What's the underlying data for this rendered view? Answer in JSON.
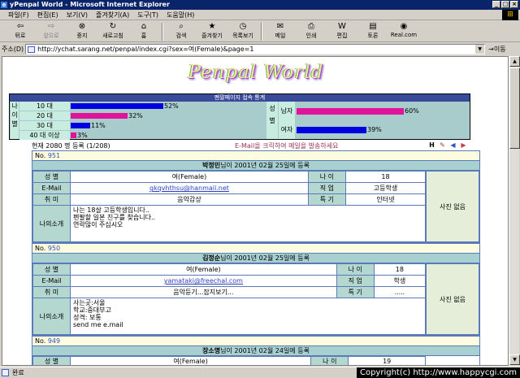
{
  "window": {
    "title": "yPenpal World - Microsoft Internet Explorer",
    "ie_glyph": "e",
    "min": "_",
    "max": "□",
    "close": "×"
  },
  "menu": [
    "파일(F)",
    "편집(E)",
    "보기(V)",
    "즐겨찾기(A)",
    "도구(T)",
    "도움말(H)"
  ],
  "toolbar": {
    "back": {
      "label": "뒤로",
      "icon": "⇦"
    },
    "forward": {
      "label": "앞으로",
      "icon": "⇨"
    },
    "stop": {
      "label": "중지",
      "icon": "⊗"
    },
    "refresh": {
      "label": "새로고침",
      "icon": "↻"
    },
    "home": {
      "label": "홈",
      "icon": "⌂"
    },
    "search": {
      "label": "검색",
      "icon": "⌕"
    },
    "favorites": {
      "label": "즐겨찾기",
      "icon": "★"
    },
    "history": {
      "label": "목록보기",
      "icon": "◷"
    },
    "mail": {
      "label": "메일",
      "icon": "✉"
    },
    "print": {
      "label": "인쇄",
      "icon": "⎙"
    },
    "edit": {
      "label": "편집",
      "icon": "W"
    },
    "discuss": {
      "label": "토론",
      "icon": "▤"
    },
    "realcom": {
      "label": "Real.com",
      "icon": "◉"
    }
  },
  "address": {
    "label": "주소(D)",
    "url": "http://ychat.sarang.net/penpal/index.cgi?sex=여(Female)&page=1",
    "go_label": "이동",
    "go_icon": "→"
  },
  "page": {
    "logo": "Penpal World",
    "stats_header": "펜팔페이지 접속 통계",
    "age_label_chars": [
      "나",
      "이",
      "별"
    ],
    "gender_label_chars": [
      "성",
      "별"
    ],
    "summary": "현재 2080 명 등록 (1/208)",
    "notice": "E-Mail을 크릭하여 메일을 발송하세요",
    "nav": {
      "h": "H",
      "pen": "✎",
      "prev": "◀",
      "next": "▶"
    }
  },
  "stats": {
    "age": [
      {
        "label": "10 대",
        "pct": 52,
        "pct_text": "52%"
      },
      {
        "label": "20 대",
        "pct": 32,
        "pct_text": "32%"
      },
      {
        "label": "30 대",
        "pct": 11,
        "pct_text": "11%"
      },
      {
        "label": "40 대 이상",
        "pct": 3,
        "pct_text": "3%"
      }
    ],
    "gender": [
      {
        "label": "남자",
        "pct": 60,
        "pct_text": "60%"
      },
      {
        "label": "여자",
        "pct": 39,
        "pct_text": "39%"
      }
    ],
    "colors": {
      "age_bars": [
        "#0000e0",
        "#e0149a",
        "#0000e0",
        "#e0149a"
      ],
      "gender_bars": [
        "#e0149a",
        "#0000e0"
      ],
      "header": "#3a4a9a"
    }
  },
  "labels": {
    "no": "No.",
    "sex": "성 별",
    "age": "나 이",
    "email": "E-Mail",
    "job": "직 업",
    "hobby": "취 미",
    "special": "특 기",
    "intro": "나의소개"
  },
  "profiles": [
    {
      "no": "951",
      "name": "박정민",
      "reg": "님이 2001년 02월 25일에 등록",
      "sex": "여(Female)",
      "age": "18",
      "email": "gkqvhthsu@hanmail.net",
      "job": "고등학생",
      "hobby": "음악감상",
      "special": "인터넷",
      "intro": [
        "나는 18살 고등학생입니다..",
        "펜팔할 일본 친구를 찾습니다..",
        "연락많이 주십시오"
      ],
      "photo": "사진 없음"
    },
    {
      "no": "950",
      "name": "김정순",
      "reg": "님이 2001년 02월 25일에 등록",
      "sex": "여(Female)",
      "age": "18",
      "email": "yamataki@freechal.com",
      "job": "학생",
      "hobby": "음악듣기...잡지보기...",
      "special": ".....",
      "intro": [
        "사는곳:서울",
        "학교:중대부고",
        "성격: 보통",
        "send me e.mail"
      ],
      "photo": "사진 없음"
    },
    {
      "no": "949",
      "name": "장소명",
      "reg": "님이 2001년 02월 24일에 등록",
      "sex": "여(Female)",
      "age": "19"
    }
  ],
  "status": {
    "text": "완료"
  },
  "copyright": "Copyright(c) http://www.happycgi.com"
}
